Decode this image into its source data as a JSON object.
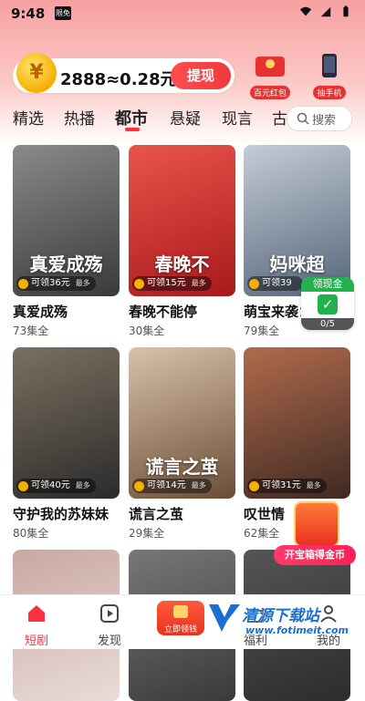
{
  "status_bar": {
    "time": "9:48",
    "app_badge": "限免"
  },
  "coin_banner": {
    "balance": "2888≈0.28元",
    "withdraw_label": "提现",
    "coin_glyph": "¥"
  },
  "promos": [
    {
      "label": "百元红包"
    },
    {
      "label": "抽手机"
    }
  ],
  "tabs": [
    {
      "label": "精选",
      "active": false
    },
    {
      "label": "热播",
      "active": false
    },
    {
      "label": "都市",
      "active": true
    },
    {
      "label": "悬疑",
      "active": false
    },
    {
      "label": "现言",
      "active": false
    },
    {
      "label": "古",
      "active": false
    }
  ],
  "search": {
    "placeholder": "搜索"
  },
  "cards": [
    {
      "poster_title": "真爱成殇",
      "title": "真爱成殇",
      "episodes": "73集全",
      "reward": "可领36元",
      "more": "最多",
      "colors": [
        "#3a3a3a",
        "#8a8a8a"
      ]
    },
    {
      "poster_title": "春晚不",
      "title": "春晚不能停",
      "episodes": "30集全",
      "reward": "可领15元",
      "more": "最多",
      "colors": [
        "#a8191c",
        "#e8554a"
      ]
    },
    {
      "poster_title": "妈咪超",
      "title": "萌宝来袭：",
      "episodes": "79集全",
      "reward": "可领39",
      "more": "",
      "colors": [
        "#56657a",
        "#c4ccd6"
      ]
    },
    {
      "poster_title": "",
      "title": "守护我的苏妹妹",
      "episodes": "80集全",
      "reward": "可领40元",
      "more": "最多",
      "colors": [
        "#2b2b2b",
        "#7a7060"
      ]
    },
    {
      "poster_title": "谎言之茧",
      "title": "谎言之茧",
      "episodes": "29集全",
      "reward": "可领14元",
      "more": "最多",
      "colors": [
        "#6b4d36",
        "#d8c2a8"
      ]
    },
    {
      "poster_title": "",
      "title": "叹世情",
      "episodes": "62集全",
      "reward": "可领31元",
      "more": "最多",
      "colors": [
        "#3f2a22",
        "#b06a4d"
      ]
    },
    {
      "poster_title": "",
      "title": "",
      "episodes": "",
      "reward": "",
      "more": "",
      "colors": [
        "#e9dcd8",
        "#caa8a2"
      ]
    },
    {
      "poster_title": "",
      "title": "",
      "episodes": "",
      "reward": "",
      "more": "",
      "colors": [
        "#3a3a3a",
        "#777"
      ]
    },
    {
      "poster_title": "",
      "title": "",
      "episodes": "",
      "reward": "",
      "more": "",
      "colors": [
        "#2c2c2c",
        "#555"
      ]
    }
  ],
  "float_cash": {
    "label": "领现金",
    "progress": "0/5"
  },
  "treasure": {
    "label": "开宝箱得金币"
  },
  "bottom_nav": [
    {
      "label": "短剧",
      "icon": "home-icon",
      "active": true
    },
    {
      "label": "发现",
      "icon": "play-icon",
      "active": false
    },
    {
      "label": "立即领钱",
      "icon": "money-icon",
      "active": false
    },
    {
      "label": "福利",
      "icon": "gift-icon",
      "active": false
    },
    {
      "label": "我的",
      "icon": "user-icon",
      "active": false
    }
  ],
  "watermark": {
    "title": "清源下载站",
    "url": "www.fotimeit.com"
  },
  "colors": {
    "accent": "#ff3040",
    "withdraw": "#f0393e",
    "green": "#23b14d"
  }
}
